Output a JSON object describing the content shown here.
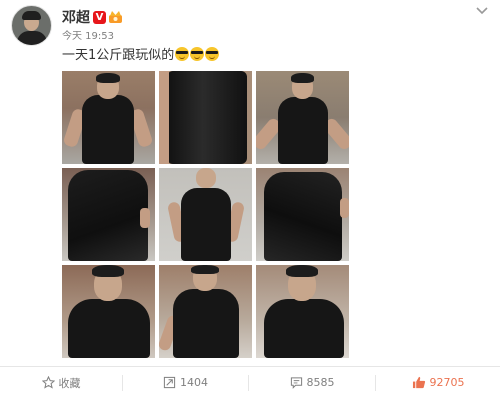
{
  "post": {
    "username": "邓超",
    "verified_badge": "V",
    "time": "今天 19:53",
    "text": "一天1公斤跟玩似的",
    "emoji": [
      "sunglasses-emoji",
      "sunglasses-emoji",
      "sunglasses-emoji"
    ]
  },
  "photos": [
    {
      "name": "photo-1",
      "scene": "front-flex-brick-wall"
    },
    {
      "name": "photo-2",
      "scene": "torso-closeup"
    },
    {
      "name": "photo-3",
      "scene": "front-shout"
    },
    {
      "name": "photo-4",
      "scene": "back-view"
    },
    {
      "name": "photo-5",
      "scene": "front-hands-on-hips"
    },
    {
      "name": "photo-6",
      "scene": "back-view-2"
    },
    {
      "name": "photo-7",
      "scene": "front-portrait"
    },
    {
      "name": "photo-8",
      "scene": "front-portrait-2"
    },
    {
      "name": "photo-9",
      "scene": "front-portrait-3"
    }
  ],
  "actions": {
    "favorite": "收藏",
    "repost": "1404",
    "comment": "8585",
    "like": "92705"
  },
  "colors": {
    "accent_like": "#eb7350",
    "verified_red": "#e7161b",
    "text_gray": "#808080"
  }
}
